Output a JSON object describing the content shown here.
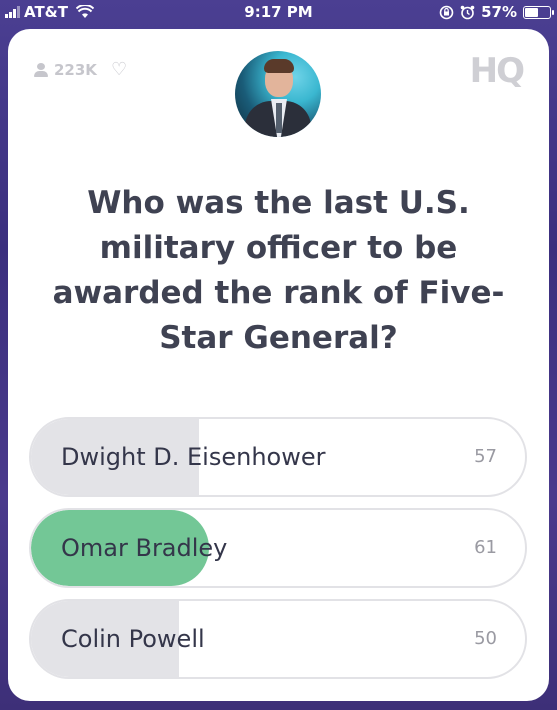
{
  "status_bar": {
    "carrier": "AT&T",
    "time": "9:17 PM",
    "battery_percent": "57%",
    "battery_level": 0.57,
    "icons": [
      "signal-icon",
      "wifi-icon",
      "rotation-lock-icon",
      "alarm-icon",
      "battery-icon"
    ]
  },
  "header": {
    "viewer_count": "223K",
    "heart_icon": "♡",
    "logo": "HQ"
  },
  "question": {
    "text": "Who was the last U.S. military officer to be awarded the rank of Five-Star General?"
  },
  "answers": [
    {
      "label": "Dwight D. Eisenhower",
      "count": "57",
      "fill": 0.34,
      "correct": false
    },
    {
      "label": "Omar Bradley",
      "count": "61",
      "fill": 0.36,
      "correct": true
    },
    {
      "label": "Colin Powell",
      "count": "50",
      "fill": 0.3,
      "correct": false
    }
  ],
  "colors": {
    "correct_fill": "#73c796",
    "answer_fill": "#e3e3e7",
    "question_text": "#3f4252",
    "background": "#3b2f7e"
  }
}
